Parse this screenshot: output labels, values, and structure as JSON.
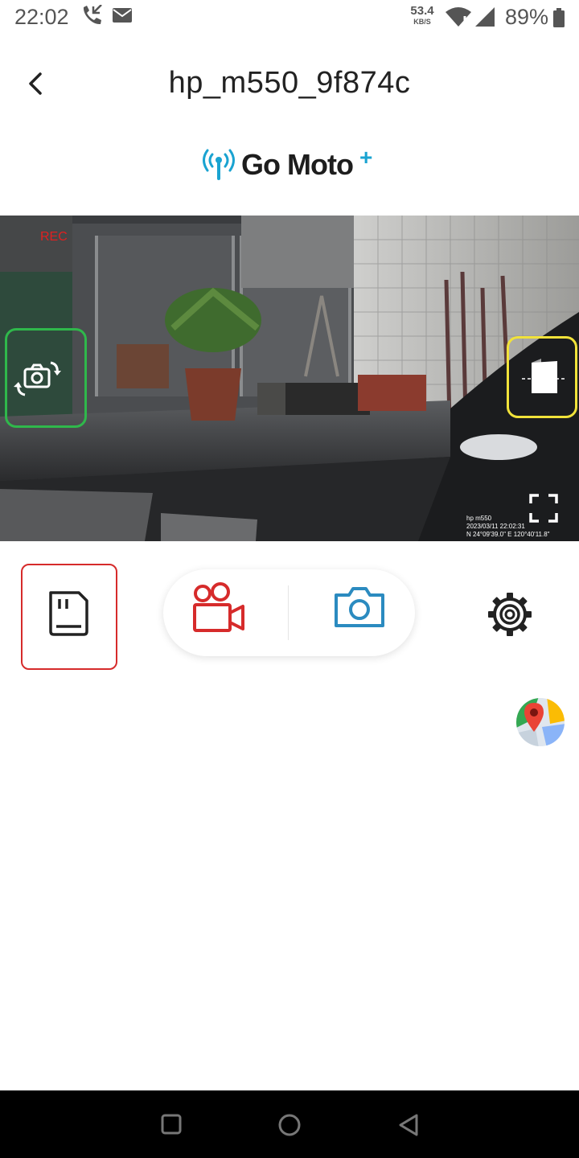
{
  "status_bar": {
    "time": "22:02",
    "network_speed_value": "53.4",
    "network_speed_unit": "KB/S",
    "battery_percent": "89%"
  },
  "header": {
    "title": "hp_m550_9f874c",
    "back_icon": "chevron-left-icon"
  },
  "logo": {
    "text": "Go Moto",
    "plus": "+",
    "accent_color": "#1aa3d1"
  },
  "video": {
    "rec_label": "REC",
    "overlay_device": "hp m550",
    "overlay_datetime": "2023/03/11 22:02:31",
    "overlay_coords": "N 24°09'39.0\"  E 120°40'11.8\"",
    "highlight_colors": {
      "switch_camera": "#2fb84b",
      "mirror": "#f1e23a"
    }
  },
  "controls": {
    "sd_card_icon": "sd-card-icon",
    "record_icon": "video-camera-icon",
    "photo_icon": "camera-icon",
    "settings_icon": "gear-icon",
    "map_icon": "map-pin-icon",
    "record_color": "#d62b2b",
    "photo_color": "#2b8bc0"
  },
  "nav_bar": {
    "recents_icon": "square-icon",
    "home_icon": "circle-icon",
    "back_icon": "triangle-back-icon"
  }
}
